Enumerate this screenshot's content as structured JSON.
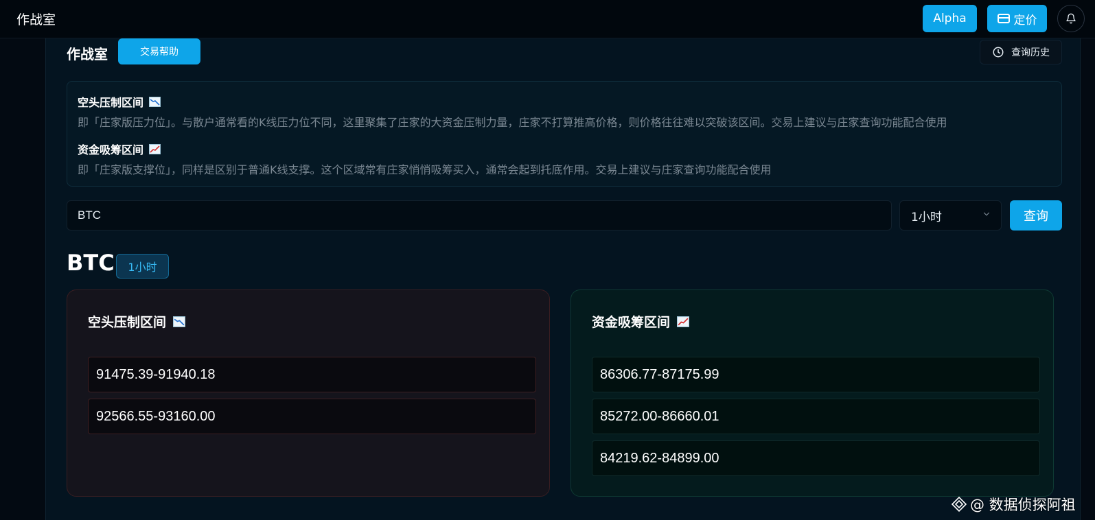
{
  "topbar": {
    "app_title": "作战室",
    "alpha_label": "Alpha",
    "pricing_label": "定价",
    "pricing_icon": "card-icon",
    "bell_icon": "bell-icon"
  },
  "page": {
    "title": "作战室",
    "help_button": "交易帮助",
    "history_button": "查询历史",
    "history_icon": "clock-icon"
  },
  "info": {
    "bear_heading": "空头压制区间",
    "bear_desc": "即「庄家版压力位」。与散户通常看的K线压力位不同，这里聚集了庄家的大资金压制力量，庄家不打算推高价格，则价格往往难以突破该区间。交易上建议与庄家查询功能配合使用",
    "bull_heading": "资金吸筹区间",
    "bull_desc": "即「庄家版支撑位」，同样是区别于普通K线支撑。这个区域常有庄家悄悄吸筹买入，通常会起到托底作用。交易上建议与庄家查询功能配合使用",
    "bear_icon": "chart-down-icon",
    "bull_icon": "chart-up-icon"
  },
  "search": {
    "value": "BTC",
    "interval_selected": "1小时",
    "query_button": "查询"
  },
  "result": {
    "symbol": "BTC",
    "interval_badge": "1小时",
    "bear_title": "空头压制区间",
    "bull_title": "资金吸筹区间",
    "bear_zones": [
      "91475.39-91940.18",
      "92566.55-93160.00"
    ],
    "bull_zones": [
      "86306.77-87175.99",
      "85272.00-86660.01",
      "84219.62-84899.00"
    ]
  },
  "watermark": {
    "text": "@ 数据侦探阿祖"
  },
  "colors": {
    "accent": "#0ea5e9",
    "bear_border": "#3a1e22",
    "bull_border": "#0f3a33",
    "chart_down_line": "#1f6fd1",
    "chart_up_line": "#d62f2f"
  }
}
